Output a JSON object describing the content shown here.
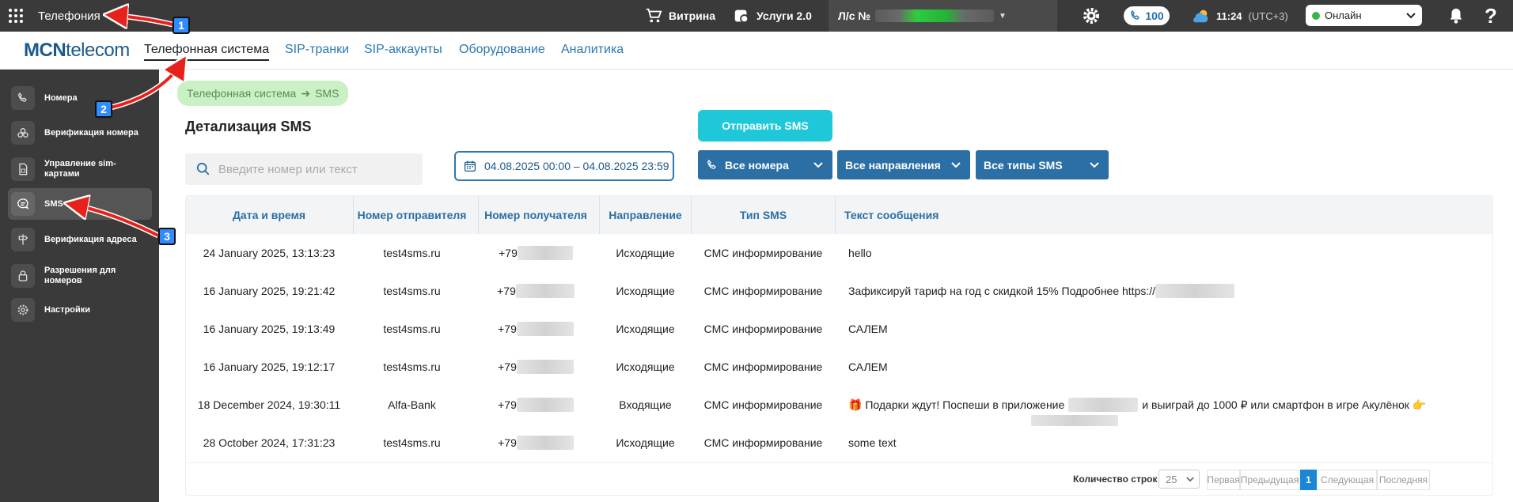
{
  "topbar": {
    "app_title": "Телефония",
    "showcase": "Витрина",
    "services": "Услуги 2.0",
    "account_prefix": "Л/с №",
    "phone_count": "100",
    "time": "11:24",
    "timezone": "(UTC+3)",
    "status": "Онлайн",
    "help": "?"
  },
  "logo": {
    "bold": "MCN",
    "rest": "telecom"
  },
  "nav_tabs": [
    "Телефонная система",
    "SIP-транки",
    "SIP-аккаунты",
    "Оборудование",
    "Аналитика"
  ],
  "sidebar": {
    "items": [
      {
        "label": "Номера",
        "icon": "phone-icon"
      },
      {
        "label": "Верификация номера",
        "icon": "verify-icon"
      },
      {
        "label": "Управление sim-картами",
        "icon": "sim-card-icon"
      },
      {
        "label": "SMS",
        "icon": "chat-icon"
      },
      {
        "label": "Верификация адреса",
        "icon": "signpost-icon"
      },
      {
        "label": "Разрешения для номеров",
        "icon": "lock-icon"
      },
      {
        "label": "Настройки",
        "icon": "gear-icon"
      }
    ],
    "active": "SMS"
  },
  "breadcrumb": {
    "parent": "Телефонная система",
    "current": "SMS"
  },
  "page_title": "Детализация SMS",
  "send_button": "Отправить SMS",
  "search": {
    "placeholder": "Введите номер или текст"
  },
  "date_range": "04.08.2025 00:00 – 04.08.2025 23:59",
  "filters": {
    "numbers": "Все номера",
    "directions": "Все направления",
    "types": "Все типы SMS"
  },
  "table": {
    "columns": [
      "Дата и время",
      "Номер отправителя",
      "Номер получателя",
      "Направление",
      "Тип SMS",
      "Текст сообщения"
    ],
    "rows": [
      {
        "date": "24 January 2025, 13:13:23",
        "sender": "test4sms.ru",
        "recipient": "+79",
        "direction": "Исходящие",
        "type": "СМС информирование",
        "text": "hello"
      },
      {
        "date": "16 January 2025, 19:21:42",
        "sender": "test4sms.ru",
        "recipient": "+79",
        "direction": "Исходящие",
        "type": "СМС информирование",
        "text": "Зафиксируй тариф на год с скидкой 15% Подробнее https://"
      },
      {
        "date": "16 January 2025, 19:13:49",
        "sender": "test4sms.ru",
        "recipient": "+79",
        "direction": "Исходящие",
        "type": "СМС информирование",
        "text": "САЛЕМ"
      },
      {
        "date": "16 January 2025, 19:12:17",
        "sender": "test4sms.ru",
        "recipient": "+79",
        "direction": "Исходящие",
        "type": "СМС информирование",
        "text": "САЛЕМ"
      },
      {
        "date": "18 December 2024, 19:30:11",
        "sender": "Alfa-Bank",
        "recipient": "+79",
        "direction": "Входящие",
        "type": "СМС информирование",
        "text_a": "🎁 Подарки ждут! Поспеши в приложение",
        "text_b": "и выиграй до 1000 ₽ или смартфон в игре Акулёнок 👉"
      },
      {
        "date": "28 October 2024, 17:31:23",
        "sender": "test4sms.ru",
        "recipient": "+79",
        "direction": "Исходящие",
        "type": "СМС информирование",
        "text": "some text"
      }
    ]
  },
  "pager": {
    "rows_label": "Количество строк",
    "rows_value": "25",
    "first": "Первая",
    "prev": "Предыдущая",
    "current": "1",
    "next": "Следующая",
    "last": "Последняя"
  },
  "annotations": {
    "badge1": "1",
    "badge2": "2",
    "badge3": "3",
    "arrow_color": "#e8221b",
    "badge_color": "#2f8bff"
  }
}
